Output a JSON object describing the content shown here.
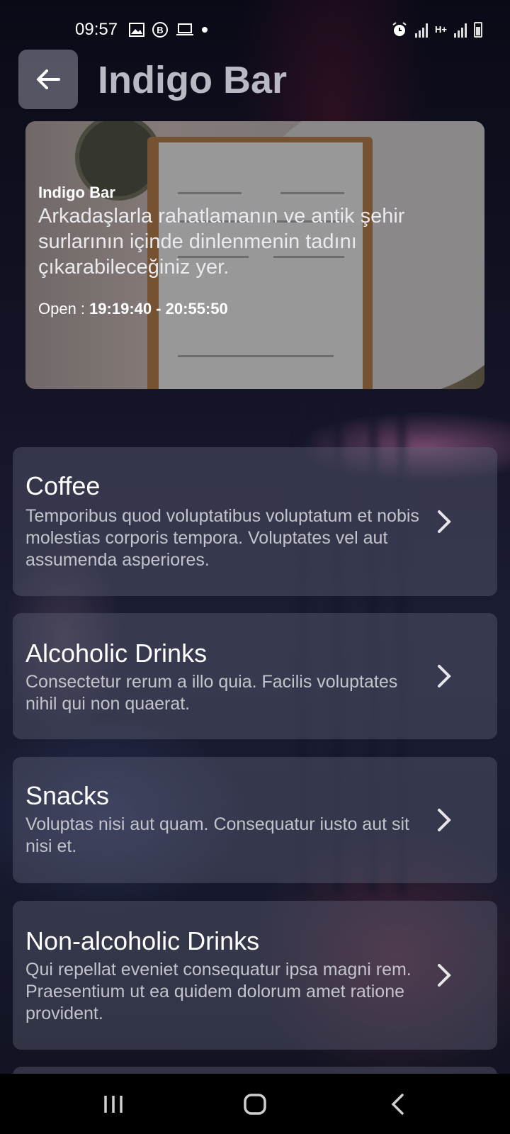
{
  "status_bar": {
    "time": "09:57",
    "left_icons": [
      "image-icon",
      "b-badge-icon",
      "laptop-icon",
      "dot-icon"
    ],
    "right_icons": [
      "alarm-icon",
      "signal-icon",
      "hplus-data-icon",
      "signal-icon",
      "battery-icon"
    ],
    "network_label": "H+"
  },
  "header": {
    "title": "Indigo Bar",
    "back_icon": "arrow-left-icon"
  },
  "hero": {
    "name": "Indigo Bar",
    "description": "Arkadaşlarla rahatlamanın ve antik şehir surlarının içinde dinlenmenin tadını çıkarabileceğiniz yer.",
    "hours_label": "Open :",
    "hours_value": "19:19:40 - 20:55:50"
  },
  "categories": [
    {
      "title": "Coffee",
      "description": "Temporibus quod voluptatibus voluptatum et nobis molestias corporis tempora. Voluptates vel aut assumenda asperiores."
    },
    {
      "title": "Alcoholic Drinks",
      "description": "Consectetur rerum a illo quia. Facilis voluptates nihil qui non quaerat."
    },
    {
      "title": "Snacks",
      "description": "Voluptas nisi aut quam. Consequatur iusto aut sit nisi et."
    },
    {
      "title": "Non-alcoholic Drinks",
      "description": "Qui repellat eveniet consequatur ipsa magni rem. Praesentium ut ea quidem dolorum amet ratione provident."
    }
  ],
  "nav_bar": {
    "recents_icon": "recents-icon",
    "home_icon": "home-icon",
    "back_icon": "back-chevron-icon"
  }
}
